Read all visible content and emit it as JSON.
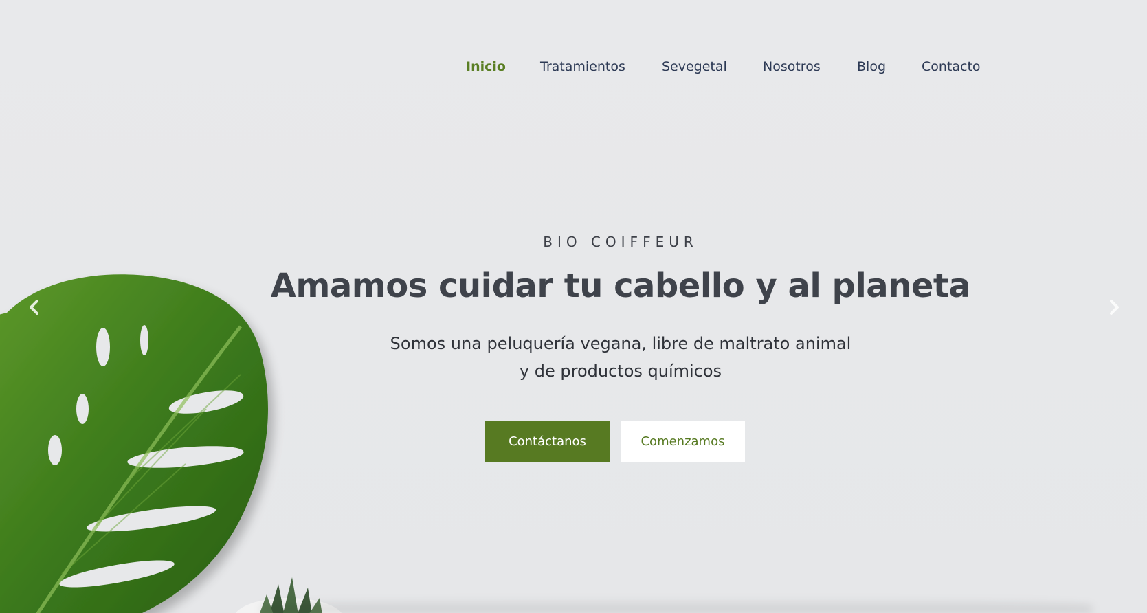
{
  "nav": {
    "items": [
      {
        "label": "Inicio",
        "active": true
      },
      {
        "label": "Tratamientos",
        "active": false
      },
      {
        "label": "Sevegetal",
        "active": false
      },
      {
        "label": "Nosotros",
        "active": false
      },
      {
        "label": "Blog",
        "active": false
      },
      {
        "label": "Contacto",
        "active": false
      }
    ]
  },
  "hero": {
    "eyebrow": "BIO COIFFEUR",
    "headline": "Amamos cuidar tu cabello y al planeta",
    "subline_1": "Somos una peluquería vegana, libre de maltrato animal",
    "subline_2": "y de productos químicos",
    "primary_button": "Contáctanos",
    "secondary_button": "Comenzamos"
  },
  "carousel": {
    "prev_icon": "chevron-left-icon",
    "next_icon": "chevron-right-icon"
  },
  "colors": {
    "accent": "#577a22",
    "background": "#e7e8ea",
    "text_dark": "#3f434b",
    "nav_text": "#2d3a55"
  }
}
